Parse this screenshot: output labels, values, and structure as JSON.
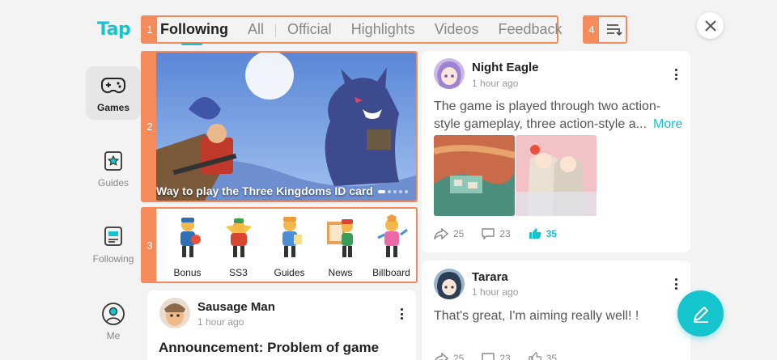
{
  "app": {
    "logo_text": "Tap",
    "brand_color": "#15c5ce",
    "marker_color": "#f58a5b"
  },
  "markers": {
    "tabs": "1",
    "banner": "2",
    "categories": "3",
    "sort": "4"
  },
  "tabs": [
    {
      "label": "Following",
      "active": true
    },
    {
      "label": "All"
    },
    {
      "label": "Official"
    },
    {
      "label": "Highlights"
    },
    {
      "label": "Videos"
    },
    {
      "label": "Feedback"
    }
  ],
  "sort": {
    "icon": "sort-list-icon"
  },
  "close": {
    "icon": "close-icon"
  },
  "nav": [
    {
      "label": "Games",
      "icon": "gamepad-icon",
      "active": true
    },
    {
      "label": "Guides",
      "icon": "star-book-icon"
    },
    {
      "label": "Following",
      "icon": "following-feed-icon"
    },
    {
      "label": "Me",
      "icon": "user-icon"
    }
  ],
  "banner": {
    "caption": "Way to play the Three Kingdoms ID card",
    "slides": 5,
    "current_slide": 1
  },
  "categories": [
    {
      "label": "Bonus"
    },
    {
      "label": "SS3"
    },
    {
      "label": "Guides"
    },
    {
      "label": "News"
    },
    {
      "label": "Billboard"
    }
  ],
  "posts": [
    {
      "author": "Night Eagle",
      "time": "1 hour ago",
      "text": "The game is played through two action-style gameplay, three action-style a...",
      "more": "More",
      "shares": "25",
      "comments": "23",
      "likes": "35"
    },
    {
      "author": "Tarara",
      "time": "1 hour ago",
      "text": "That's great, I'm aiming really well! !",
      "shares": "25",
      "comments": "23",
      "likes": "35"
    },
    {
      "author": "Sausage Man",
      "time": "1 hour ago",
      "title": "Announcement: Problem of game"
    }
  ],
  "fab": {
    "icon": "compose-pen-icon"
  }
}
